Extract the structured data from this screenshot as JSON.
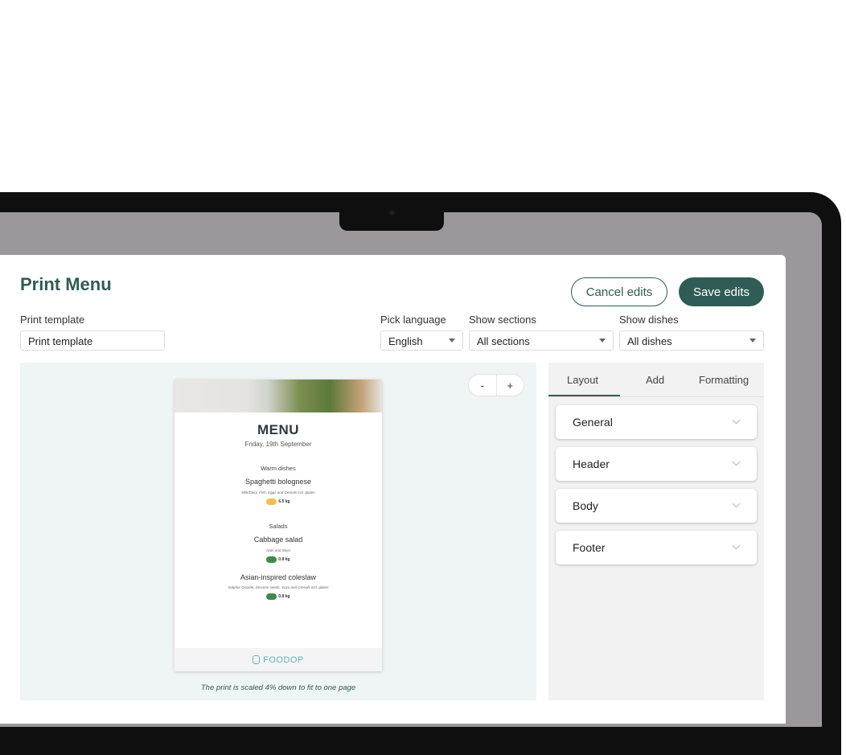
{
  "page": {
    "title": "Print Menu"
  },
  "actions": {
    "cancel_label": "Cancel edits",
    "save_label": "Save edits"
  },
  "fields": {
    "template": {
      "label": "Print template",
      "value": "Print template"
    },
    "language": {
      "label": "Pick language",
      "value": "English"
    },
    "sections": {
      "label": "Show sections",
      "value": "All sections"
    },
    "dishes": {
      "label": "Show dishes",
      "value": "All dishes"
    }
  },
  "zoom": {
    "minus": "-",
    "plus": "+"
  },
  "menu_preview": {
    "title": "MENU",
    "date": "Friday, 19th September",
    "sections": [
      {
        "name": "Warm dishes",
        "dishes": [
          {
            "name": "Spaghetti bolognese",
            "allergens": "Milk/Dairy, Fish, Eggs and Cereals incl. gluten",
            "co2": "6.5 kg",
            "co2_color": "#f1c04e"
          }
        ]
      },
      {
        "name": "Salads",
        "dishes": [
          {
            "name": "Cabbage salad",
            "allergens": "Nuts and Soya",
            "co2": "0.8 kg",
            "co2_color": "#3f8a4a"
          },
          {
            "name": "Asian-inspired coleslaw",
            "allergens": "Sulphur Dioxide, Sesame seeds, Soya and Cereals incl. gluten",
            "co2": "0.8 kg",
            "co2_color": "#3f8a4a"
          }
        ]
      }
    ],
    "footer_logo": "FOODOP"
  },
  "scale_note": "The print is scaled 4% down to fit to one page",
  "settings": {
    "tabs": [
      "Layout",
      "Add",
      "Formatting"
    ],
    "active_tab": "Layout",
    "sections": [
      "General",
      "Header",
      "Body",
      "Footer"
    ]
  },
  "colors": {
    "accent": "#2f5c55",
    "preview_bg": "#eff4f5",
    "panel_bg": "#f2f2f3",
    "logo": "#5eb6b2"
  }
}
